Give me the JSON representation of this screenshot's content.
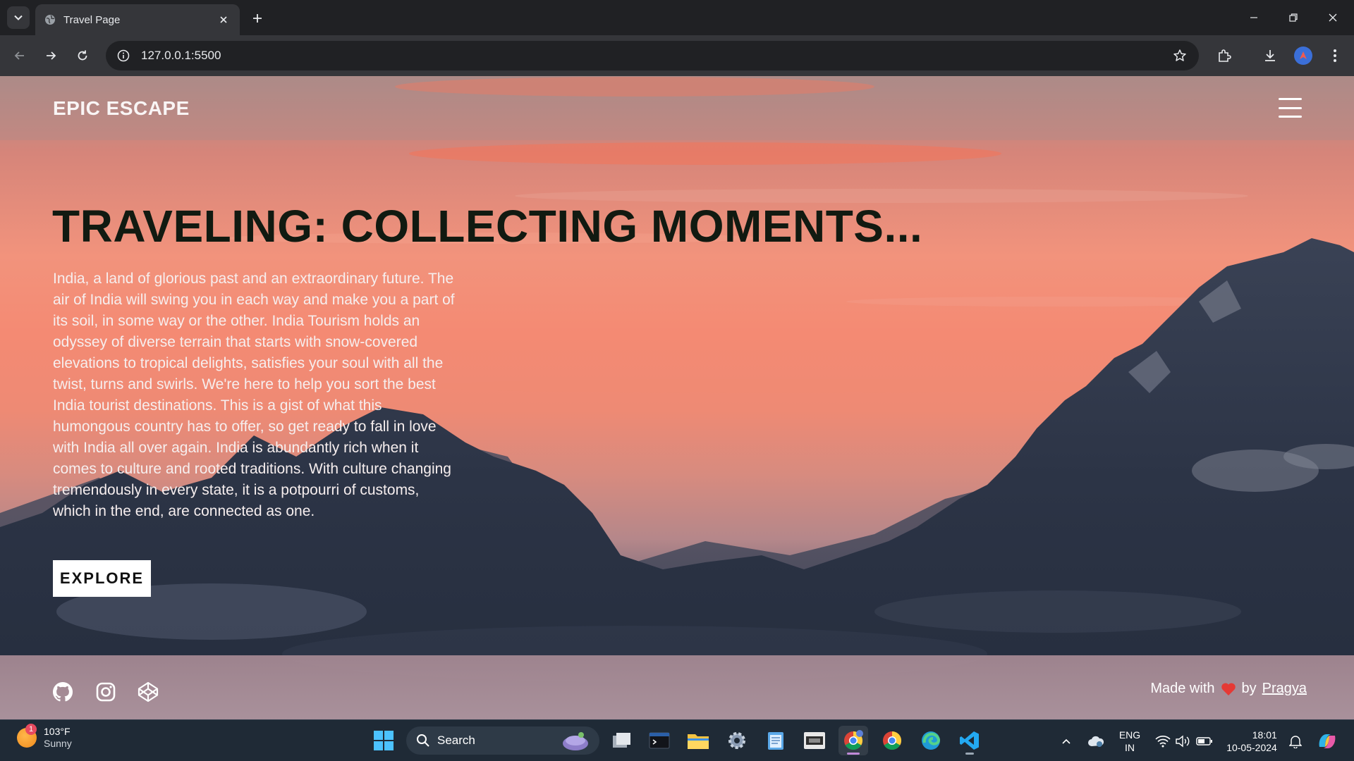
{
  "browser": {
    "tab_title": "Travel Page",
    "url": "127.0.0.1:5500"
  },
  "site": {
    "logo": "EPIC ESCAPE",
    "hero_title": "TRAVELING: COLLECTING MOMENTS...",
    "hero_text": "India, a land of glorious past and an extraordinary future. The air of India will swing you in each way and make you a part of its soil, in some way or the other. India Tourism holds an odyssey of diverse terrain that starts with snow-covered elevations to tropical delights, satisfies your soul with all the twist, turns and swirls. We're here to help you sort the best India tourist destinations. This is a gist of what this humongous country has to offer, so get ready to fall in love with India all over again. India is abundantly rich when it comes to culture and rooted traditions. With culture changing tremendously in every state, it is a potpourri of customs, which in the end, are connected as one.",
    "explore_label": "EXPLORE",
    "footer": {
      "made_with": "Made with",
      "by": "by",
      "author": "Pragya",
      "social_icons": [
        "github-icon",
        "instagram-icon",
        "codepen-icon"
      ]
    }
  },
  "taskbar": {
    "weather_temp": "103°F",
    "weather_cond": "Sunny",
    "weather_badge": "1",
    "search_label": "Search",
    "lang_line1": "ENG",
    "lang_line2": "IN",
    "time": "18:01",
    "date": "10-05-2024"
  },
  "colors": {
    "sky_top": "#ae8a86",
    "sky_mid": "#f2937c",
    "mountain": "#2b3447",
    "hero_title": "#111a11",
    "taskbar": "#1f2a36",
    "heart": "#e53935"
  }
}
